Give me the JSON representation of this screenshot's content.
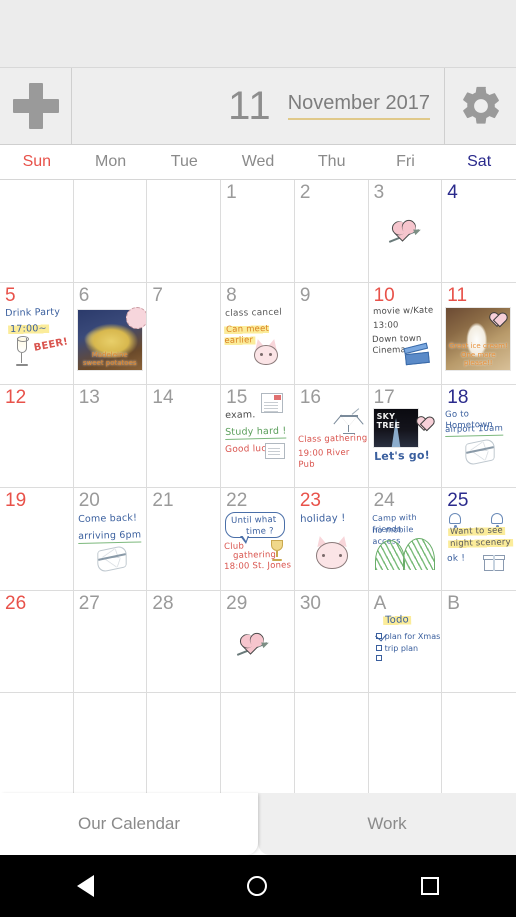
{
  "toolbar": {
    "add_label": "+",
    "month_number": "11",
    "month_year": "November 2017",
    "settings_label": "settings"
  },
  "weekdays": [
    "Sun",
    "Mon",
    "Tue",
    "Wed",
    "Thu",
    "Fri",
    "Sat"
  ],
  "cells": [
    {
      "num": "",
      "kind": "blank"
    },
    {
      "num": "",
      "kind": "blank"
    },
    {
      "num": "",
      "kind": "blank"
    },
    {
      "num": "1",
      "kind": "day"
    },
    {
      "num": "2",
      "kind": "day"
    },
    {
      "num": "3",
      "kind": "day"
    },
    {
      "num": "4",
      "kind": "day"
    },
    {
      "num": "5",
      "kind": "day",
      "l1": "Drink Party",
      "l2": "17:00~",
      "l3": "BEER!"
    },
    {
      "num": "6",
      "kind": "day",
      "caption": "Madeleine\nsweet potatoes"
    },
    {
      "num": "7",
      "kind": "day"
    },
    {
      "num": "8",
      "kind": "day",
      "l1": "class cancel",
      "l2": "Can meet earlier"
    },
    {
      "num": "9",
      "kind": "day"
    },
    {
      "num": "10",
      "kind": "day",
      "l1": "movie w/Kate",
      "l2": "13:00",
      "l3": "Down town Cinema"
    },
    {
      "num": "11",
      "kind": "day",
      "caption": "Great ice cream!\nOne more please!!"
    },
    {
      "num": "12",
      "kind": "day"
    },
    {
      "num": "13",
      "kind": "day"
    },
    {
      "num": "14",
      "kind": "day"
    },
    {
      "num": "15",
      "kind": "day",
      "l1": "exam.",
      "l2": "Study hard !",
      "l3": "Good luck"
    },
    {
      "num": "16",
      "kind": "day",
      "l1": "Class gathering",
      "l2": "19:00 River Pub"
    },
    {
      "num": "17",
      "kind": "day",
      "photo_label": "SKY\nTREE",
      "l1": "Let's go!"
    },
    {
      "num": "18",
      "kind": "day",
      "l1": "Go to Hometown",
      "l2": "airport 10am"
    },
    {
      "num": "19",
      "kind": "day"
    },
    {
      "num": "20",
      "kind": "day",
      "l1": "Come back!",
      "l2": "arriving 6pm"
    },
    {
      "num": "21",
      "kind": "day"
    },
    {
      "num": "22",
      "kind": "day",
      "bubble1": "Until what",
      "bubble2": "time ?",
      "l1": "Club",
      "l2": "gathering",
      "l3": "18:00 St. Jones"
    },
    {
      "num": "23",
      "kind": "day",
      "l1": "holiday !"
    },
    {
      "num": "24",
      "kind": "day",
      "l1": "Camp with friends",
      "l2": "no mobile access"
    },
    {
      "num": "25",
      "kind": "day",
      "l1": "Want to see",
      "l2": "night scenery",
      "l3": "ok !"
    },
    {
      "num": "26",
      "kind": "day"
    },
    {
      "num": "27",
      "kind": "day"
    },
    {
      "num": "28",
      "kind": "day"
    },
    {
      "num": "29",
      "kind": "day"
    },
    {
      "num": "30",
      "kind": "day"
    },
    {
      "num": "A",
      "kind": "day",
      "todo_title": "Todo",
      "todo1": "plan for Xmas",
      "todo2": "trip plan",
      "todo3": ""
    },
    {
      "num": "B",
      "kind": "day"
    },
    {
      "num": "",
      "kind": "blank"
    },
    {
      "num": "",
      "kind": "blank"
    },
    {
      "num": "",
      "kind": "blank"
    },
    {
      "num": "",
      "kind": "blank"
    },
    {
      "num": "",
      "kind": "blank"
    },
    {
      "num": "",
      "kind": "blank"
    },
    {
      "num": "",
      "kind": "blank"
    }
  ],
  "bottom_tabs": [
    {
      "label": "Our Calendar",
      "active": true
    },
    {
      "label": "Work",
      "active": false
    }
  ],
  "nav": {
    "back": "back",
    "home": "home",
    "recent": "recents"
  },
  "colors": {
    "sunday": "#e8524a",
    "saturday": "#2a2a8c",
    "weekday": "#8a8a8a",
    "accent_underline": "#e0c98a",
    "toolbar_bg": "#eeeeee",
    "highlight_yellow": "#fbec9a"
  }
}
